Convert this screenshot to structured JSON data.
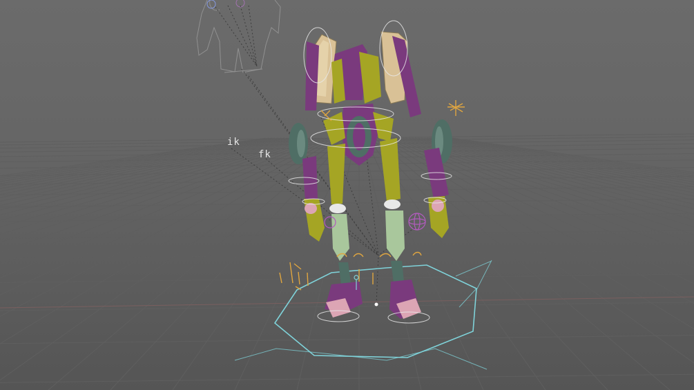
{
  "viewport": {
    "background_top": "#6b6b6b",
    "background_bottom": "#555555",
    "grid_color": "#5f5f5f",
    "grid_axis_color": "#7a5f5f"
  },
  "labels": {
    "ik": "ik",
    "fk": "fk"
  },
  "rig": {
    "purple": "#7a3a7d",
    "olive": "#a5a524",
    "teal": "#4f6e65",
    "beige": "#d9c196",
    "sage": "#a9c79c",
    "pink": "#dca5b4",
    "cyan_ctrl": "#7fd3da",
    "orange_ctrl": "#e0a640",
    "white_ctrl": "#e8e8e8",
    "magenta_ctrl": "#b35bbf"
  }
}
